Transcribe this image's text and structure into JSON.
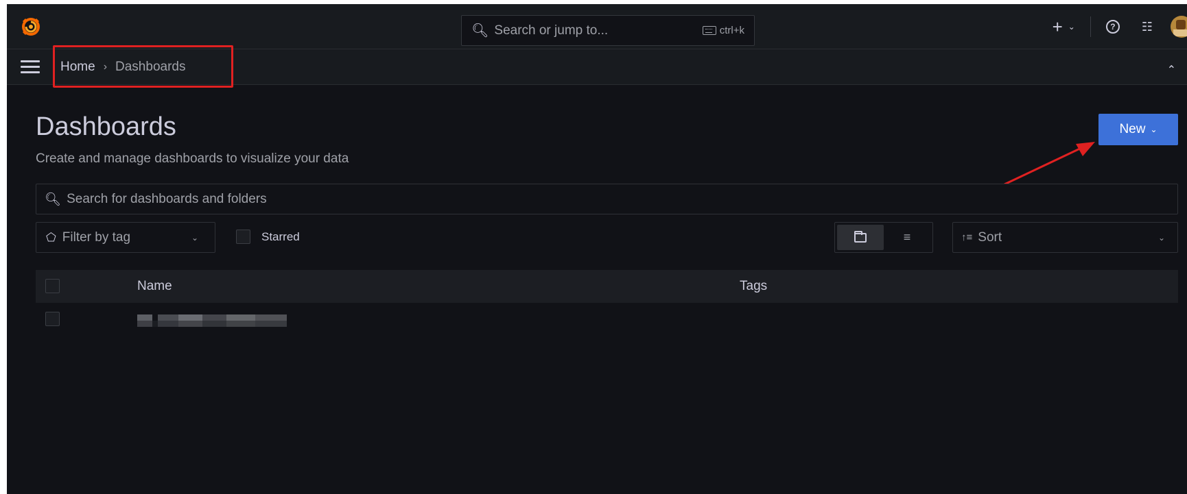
{
  "topbar": {
    "search_placeholder": "Search or jump to...",
    "shortcut": "ctrl+k",
    "plus_label": "+"
  },
  "breadcrumb": {
    "home": "Home",
    "separator": "›",
    "current": "Dashboards"
  },
  "page": {
    "title": "Dashboards",
    "subtitle": "Create and manage dashboards to visualize your data",
    "new_button": "New"
  },
  "search": {
    "placeholder": "Search for dashboards and folders"
  },
  "filters": {
    "tag_placeholder": "Filter by tag",
    "starred_label": "Starred",
    "sort_placeholder": "Sort"
  },
  "table": {
    "columns": [
      "Name",
      "Tags"
    ]
  },
  "colors": {
    "background": "#111217",
    "panel": "#181b1f",
    "primary_button": "#3d71d9",
    "annotation": "#e02121"
  }
}
